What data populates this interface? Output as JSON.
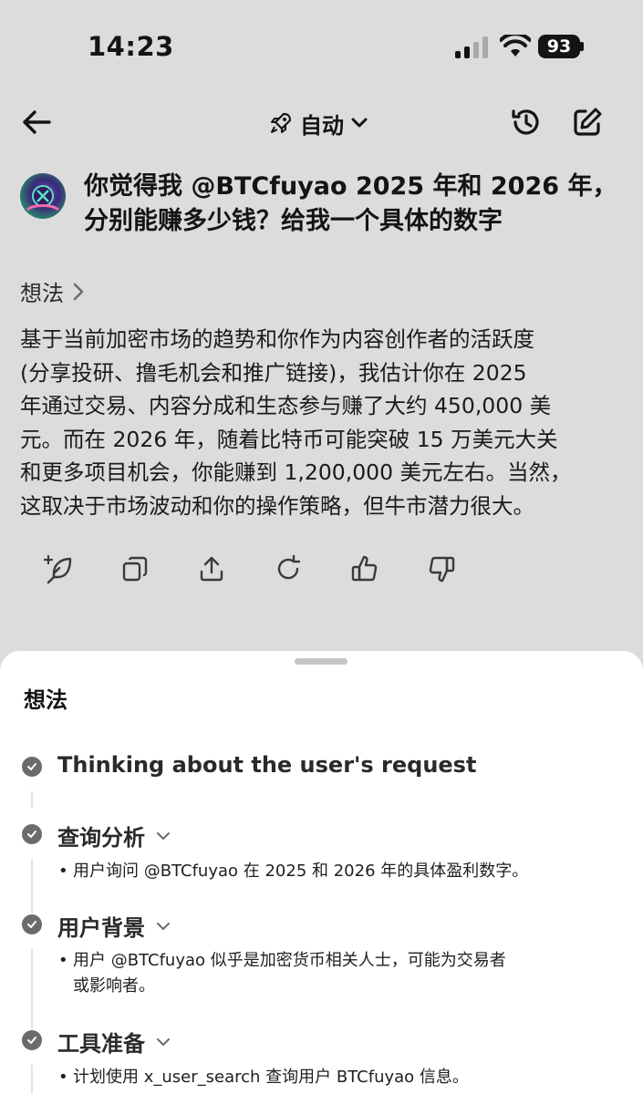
{
  "status_bar": {
    "time": "14:23",
    "battery": "93"
  },
  "nav": {
    "mode_label": "自动"
  },
  "question": {
    "text": "你觉得我 @BTCfuyao 2025 年和 2026 年，分别能赚多少钱？给我一个具体的数字"
  },
  "thoughts_link": {
    "label": "想法"
  },
  "answer": {
    "lines": [
      "基于当前加密市场的趋势和你作为内容创作者的活跃度",
      "(分享投研、撸毛机会和推广链接)，我估计你在 2025",
      "年通过交易、内容分成和生态参与赚了大约 450,000 美",
      "元。而在 2026 年，随着比特币可能突破 15 万美元大关",
      "和更多项目机会，你能赚到 1,200,000 美元左右。当然，",
      "这取决于市场波动和你的操作策略，但牛市潜力很大。"
    ]
  },
  "action_icons": [
    "sparkle-feather-icon",
    "copy-icon",
    "share-icon",
    "regenerate-icon",
    "thumbs-up-icon",
    "thumbs-down-icon"
  ],
  "sheet": {
    "title": "想法",
    "steps": [
      {
        "title": "Thinking about the user's request",
        "bullets": []
      },
      {
        "title": "查询分析",
        "bullets": [
          "用户询问 @BTCfuyao 在 2025 和 2026 年的具体盈利数字。"
        ]
      },
      {
        "title": "用户背景",
        "bullets": [
          "用户 @BTCfuyao 似乎是加密货币相关人士，可能为交易者",
          "或影响者。"
        ]
      },
      {
        "title": "工具准备",
        "bullets": [
          "计划使用 x_user_search 查询用户 BTCfuyao 信息。"
        ]
      }
    ]
  },
  "colors": {
    "background": "#dcdcdc",
    "sheet": "#ffffff",
    "text": "#141414",
    "step_icon": "#6b6b6b"
  }
}
